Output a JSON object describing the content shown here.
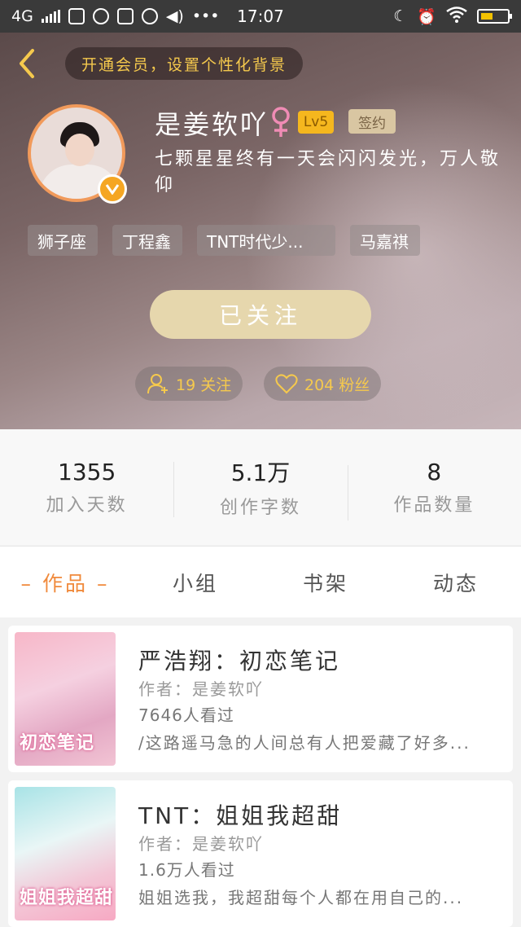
{
  "status_bar": {
    "network": "4G",
    "time": "17:07"
  },
  "header": {
    "vip_banner": "开通会员，设置个性化背景",
    "user_name": "是姜软吖",
    "level": "Lv5",
    "sign_badge": "签约",
    "bio": "七颗星星终有一天会闪闪发光，万人敬仰",
    "tags": [
      "狮子座",
      "丁程鑫",
      "TNT时代少...",
      "马嘉祺"
    ],
    "follow_button": "已关注",
    "following_count": "19 关注",
    "fans_count": "204 粉丝"
  },
  "stats": [
    {
      "value": "1355",
      "label": "加入天数"
    },
    {
      "value": "5.1万",
      "label": "创作字数"
    },
    {
      "value": "8",
      "label": "作品数量"
    }
  ],
  "tabs": [
    {
      "label": "– 作品 –",
      "active": true
    },
    {
      "label": "小组",
      "active": false
    },
    {
      "label": "书架",
      "active": false
    },
    {
      "label": "动态",
      "active": false
    }
  ],
  "works": [
    {
      "title": "严浩翔：初恋笔记",
      "author": "作者：是姜软吖",
      "views": "7646人看过",
      "excerpt": "/这路遥马急的人间总有人把爱藏了好多...",
      "cover_text": "初恋笔记"
    },
    {
      "title": "TNT：姐姐我超甜",
      "author": "作者：是姜软吖",
      "views": "1.6万人看过",
      "excerpt": "姐姐选我，我超甜每个人都在用自己的...",
      "cover_text": "姐姐我超甜"
    }
  ],
  "colors": {
    "accent": "#f08a3c",
    "gold": "#f5c94d",
    "follow_button": "#e6d7ad",
    "level_badge": "#f5b71e"
  }
}
